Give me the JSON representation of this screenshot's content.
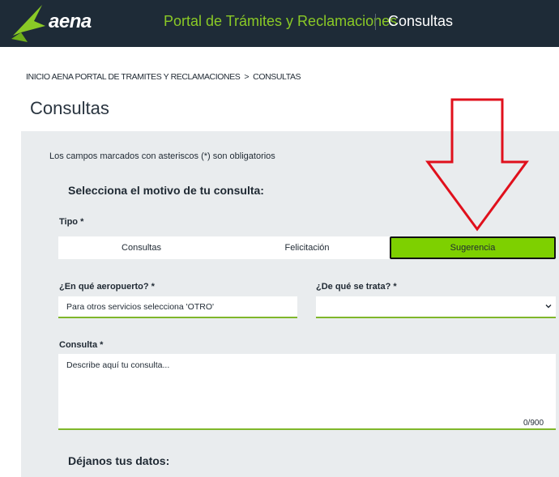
{
  "header": {
    "logo_text": "aena",
    "portal_title": "Portal de Trámites y Reclamaciones",
    "section_title": "Consultas"
  },
  "breadcrumb": {
    "home": "INICIO AENA PORTAL DE TRAMITES Y RECLAMACIONES",
    "separator": ">",
    "current": "CONSULTAS"
  },
  "page": {
    "title": "Consultas"
  },
  "form": {
    "required_note": "Los campos marcados con asteriscos (*) son obligatorios",
    "motivo_heading": "Selecciona el motivo de tu consulta:",
    "tipo_label": "Tipo *",
    "tabs": [
      {
        "label": "Consultas",
        "selected": false
      },
      {
        "label": "Felicitación",
        "selected": false
      },
      {
        "label": "Sugerencia",
        "selected": true
      }
    ],
    "airport": {
      "label": "¿En qué aeropuerto? *",
      "placeholder": "Para otros servicios selecciona 'OTRO'",
      "value": ""
    },
    "trata": {
      "label": "¿De qué se trata? *",
      "value": ""
    },
    "consulta": {
      "label": "Consulta *",
      "placeholder": "Describe aquí tu consulta...",
      "value": "",
      "counter": "0/900"
    },
    "datos_heading": "Déjanos tus datos:"
  },
  "colors": {
    "header_bg": "#1e2b37",
    "brand_green": "#8ac926",
    "selected_tab": "#7ed000",
    "panel_bg": "#e9ecee",
    "field_underline": "#7fb72a",
    "annotation_arrow": "#e0101c"
  },
  "icons": {
    "logo": "aena-logo-icon",
    "select_chevron": "chevron-down-icon",
    "annotation": "red-down-arrow"
  }
}
